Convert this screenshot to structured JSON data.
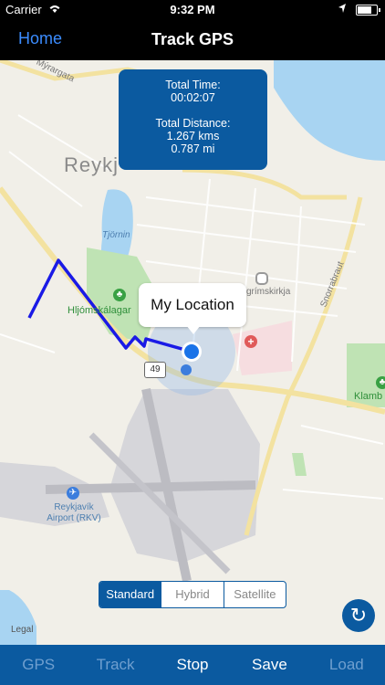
{
  "status_bar": {
    "carrier": "Carrier",
    "time": "9:32 PM"
  },
  "nav": {
    "home_label": "Home",
    "title": "Track GPS"
  },
  "tracking_info": {
    "time_label": "Total Time:",
    "time_value": "00:02:07",
    "distance_label": "Total Distance:",
    "distance_kms": "1.267 kms",
    "distance_mi": "0.787 mi"
  },
  "map_labels": {
    "street_top": "Mýrargata",
    "city": "Reykj",
    "lake": "Tjörnin",
    "park": "Hljómskálagar",
    "church": "grímskirkja",
    "road": "Snorrabraut",
    "route_number": "49",
    "park_right": "Klamb",
    "airport_line1": "Reykjavík",
    "airport_line2": "Airport (RKV)"
  },
  "callout": {
    "text": "My Location"
  },
  "map_type": {
    "options": [
      "Standard",
      "Hybrid",
      "Satellite"
    ],
    "selected": "Standard"
  },
  "legal": "Legal",
  "toolbar": {
    "items": [
      {
        "label": "GPS",
        "enabled": false
      },
      {
        "label": "Track",
        "enabled": false
      },
      {
        "label": "Stop",
        "enabled": true
      },
      {
        "label": "Save",
        "enabled": true
      },
      {
        "label": "Load",
        "enabled": false
      }
    ]
  },
  "colors": {
    "accent": "#0b5aa0",
    "route": "#1a1ae6",
    "location_dot": "#1a73e8",
    "link": "#3b8cff"
  },
  "icons": {
    "wifi": "wifi-icon",
    "location_arrow": "location-arrow-icon",
    "battery": "battery-icon",
    "refresh": "refresh-icon",
    "airport": "airplane-icon",
    "park": "tree-icon",
    "church": "place-icon",
    "hospital": "hospital-icon",
    "bus": "bus-icon"
  }
}
